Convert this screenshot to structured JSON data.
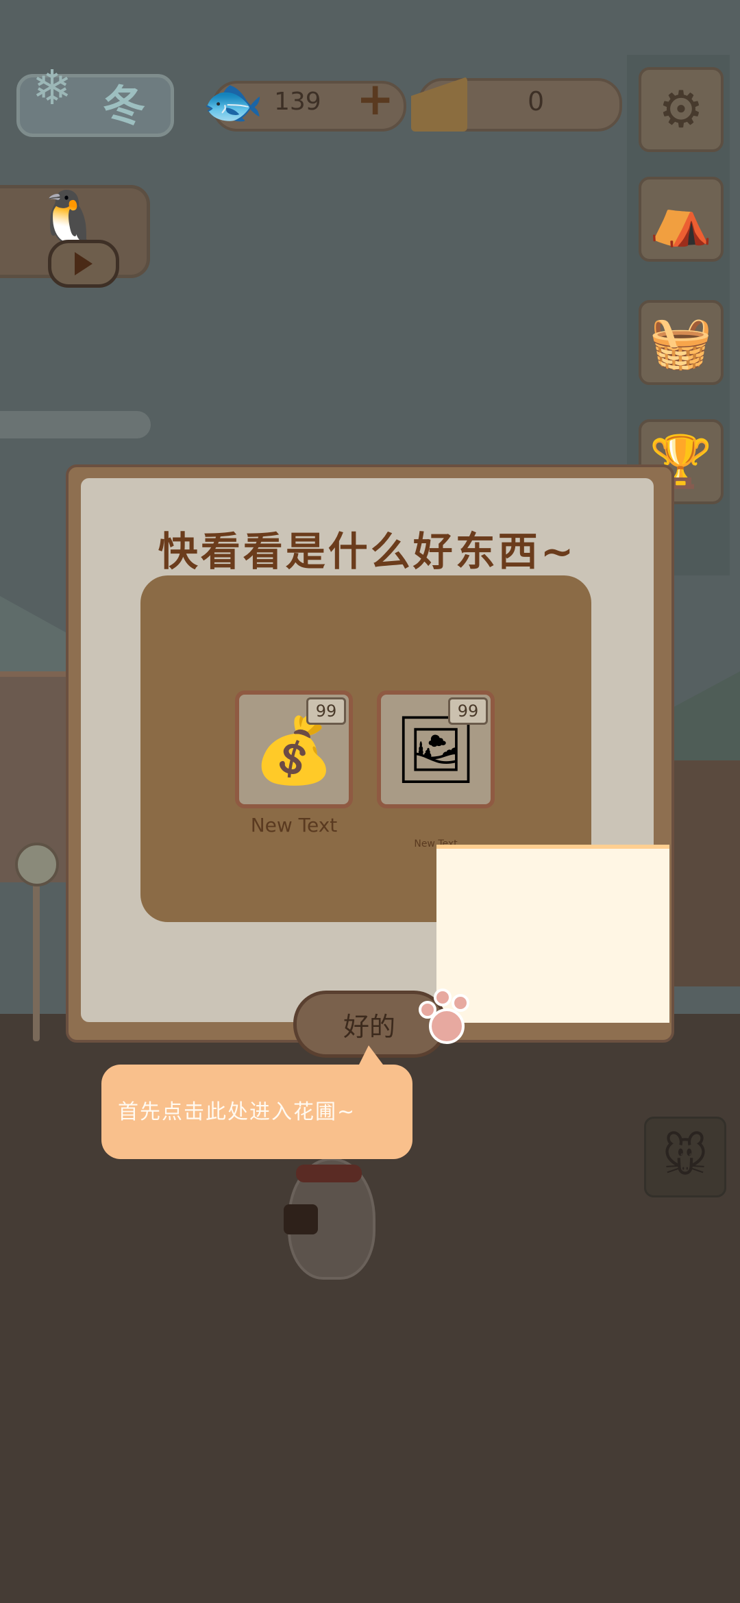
{
  "season": {
    "label": "冬",
    "icon": "snow-tree-icon"
  },
  "currencies": {
    "fish": {
      "icon": "fish-bone-icon",
      "value": "139",
      "add_label": "+"
    },
    "cheese": {
      "icon": "cheese-icon",
      "value": "0"
    }
  },
  "video_ad": {
    "icon": "play-icon",
    "character_icon": "penguin-icon"
  },
  "sidebar": {
    "items": [
      {
        "name": "settings",
        "icon": "gear-icon",
        "glyph": "⚙"
      },
      {
        "name": "shop",
        "icon": "market-stall-icon",
        "glyph": "⛺"
      },
      {
        "name": "basket",
        "icon": "basket-icon",
        "glyph": "🧺"
      },
      {
        "name": "trophy",
        "icon": "trophy-icon",
        "glyph": "🏆"
      }
    ]
  },
  "dialog": {
    "title": "快看看是什么好东西~",
    "items": [
      {
        "name": "New Text",
        "count": "99",
        "icon": "flower-seed-bag-icon",
        "glyph": "💰"
      },
      {
        "name": "New Text",
        "count": "99",
        "icon": "picture-seed-bag-icon",
        "glyph": "🖼"
      }
    ],
    "confirm_label": "好的"
  },
  "tutorial": {
    "tip": "首先点击此处进入花圃~",
    "pointer_icon": "paw-icon"
  },
  "mouse_shop": {
    "icon": "mouse-shopkeeper-icon",
    "glyph": "🐭"
  },
  "colors": {
    "dialog_title": "#6b3c1c",
    "highlight": "#fff6e4",
    "tip_bubble": "#f9c08c"
  }
}
